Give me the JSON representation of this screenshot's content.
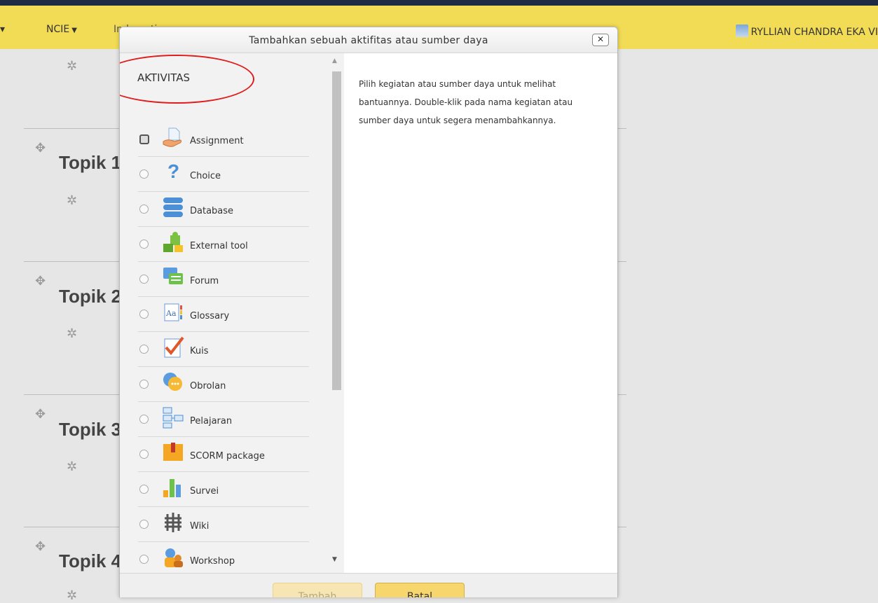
{
  "navbar": {
    "item1": "NCIE",
    "item2": "Ind... ...ti...",
    "user": "RYLLIAN CHANDRA EKA VI"
  },
  "course": {
    "topics": [
      "Topik 1",
      "Topik 2",
      "Topik 3",
      "Topik 4"
    ]
  },
  "modal": {
    "title": "Tambahkan sebuah aktifitas atau sumber daya",
    "close": "✕",
    "section_heading": "AKTIVITAS",
    "items": [
      {
        "label": "Assignment",
        "icon": "assignment-icon",
        "selected": true
      },
      {
        "label": "Choice",
        "icon": "choice-icon"
      },
      {
        "label": "Database",
        "icon": "database-icon"
      },
      {
        "label": "External tool",
        "icon": "external-tool-icon"
      },
      {
        "label": "Forum",
        "icon": "forum-icon"
      },
      {
        "label": "Glossary",
        "icon": "glossary-icon"
      },
      {
        "label": "Kuis",
        "icon": "quiz-icon"
      },
      {
        "label": "Obrolan",
        "icon": "chat-icon"
      },
      {
        "label": "Pelajaran",
        "icon": "lesson-icon"
      },
      {
        "label": "SCORM package",
        "icon": "scorm-icon"
      },
      {
        "label": "Survei",
        "icon": "survey-icon"
      },
      {
        "label": "Wiki",
        "icon": "wiki-icon"
      },
      {
        "label": "Workshop",
        "icon": "workshop-icon"
      }
    ],
    "help_text": "Pilih kegiatan atau sumber daya untuk melihat bantuannya. Double-klik pada nama kegiatan atau sumber daya untuk segera menambahkannya.",
    "add_button": "Tambah",
    "cancel_button": "Batal"
  },
  "colors": {
    "navbar": "#f2dc55",
    "annotation": "#e01c1c"
  }
}
